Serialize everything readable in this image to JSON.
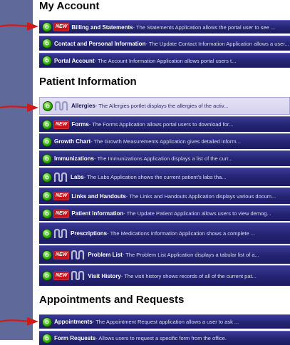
{
  "sections": {
    "my_account": {
      "title": "My Account",
      "rows": [
        {
          "title": "Billing and Statements",
          "desc": " - The Statements Application allows the portal user to see ...",
          "new": true,
          "nw": false
        },
        {
          "title": "Contact and Personal Information",
          "desc": " - The Update Contact Information Application allows a user...",
          "new": false,
          "nw": false
        },
        {
          "title": "Portal Account",
          "desc": " - The Account Information Application allows portal users t...",
          "new": false,
          "nw": false
        }
      ]
    },
    "patient_information": {
      "title": "Patient Information",
      "rows": [
        {
          "title": "Allergies",
          "desc": " - The Allergies portlet displays the allergies of the activ...",
          "new": false,
          "nw": true
        },
        {
          "title": "Forms",
          "desc": " - The Forms Application allows portal users to download for...",
          "new": true,
          "nw": false
        },
        {
          "title": "Growth Chart",
          "desc": " - The Growth Measurements Application gives detailed inform...",
          "new": false,
          "nw": false
        },
        {
          "title": "Immunizations",
          "desc": " - The Immunizations Application displays a list of the curr...",
          "new": false,
          "nw": false
        },
        {
          "title": "Labs",
          "desc": " - The Labs Application shows the current patient's labs tha...",
          "new": false,
          "nw": true
        },
        {
          "title": "Links and Handouts",
          "desc": " - The Links and Handouts Application displays various docum...",
          "new": true,
          "nw": false
        },
        {
          "title": "Patient Information",
          "desc": " - The Update Patient Application allows users to view demog...",
          "new": true,
          "nw": false
        },
        {
          "title": "Prescriptions",
          "desc": " - The Medications Information Application shows a complete ...",
          "new": false,
          "nw": true
        },
        {
          "title": "Problem List",
          "desc": " - The Problem List Application displays a tabular list of a...",
          "new": true,
          "nw": true
        },
        {
          "title": "Visit History",
          "desc": " - The visit history shows records of all of the current pat...",
          "new": true,
          "nw": true
        }
      ]
    },
    "appointments_requests": {
      "title": "Appointments and Requests",
      "rows": [
        {
          "title": "Appointments",
          "desc": " - The Appointment Request application allows a user to ask ...",
          "new": false,
          "nw": false
        },
        {
          "title": "Form Requests",
          "desc": " - Allows users to request a specific form from the office.",
          "new": false,
          "nw": false
        }
      ]
    }
  },
  "new_badge_label": "NEW",
  "icons": {
    "go": "green-go-icon",
    "nw": "nw-logo-icon",
    "arrow": "red-arrow-icon"
  },
  "colors": {
    "row": "#232372",
    "selected_row": "#dcd8f2",
    "new_badge": "#c8121b",
    "sidebar": "#5f6a9a",
    "arrow": "#d11a1a"
  }
}
